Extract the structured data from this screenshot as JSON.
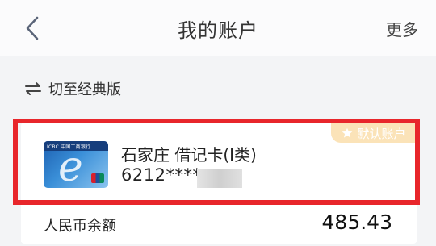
{
  "header": {
    "title": "我的账户",
    "more_label": "更多",
    "back_icon": "chevron-left-icon"
  },
  "switch": {
    "label": "切至经典版",
    "icon": "swap-arrows-icon"
  },
  "account_card": {
    "badge_label": "默认账户",
    "badge_icon": "star-icon",
    "card_icon": "bank-card-icon",
    "card_brand": "ICBC 中国工商银行",
    "name": "石家庄 借记卡(I类)",
    "number_visible": "6212****",
    "balance_label": "人民币余额",
    "balance_value": "485.43"
  },
  "colors": {
    "highlight": "#e8262b",
    "badge_bg": "#fbe3b8",
    "page_bg": "#f3f4f6"
  }
}
